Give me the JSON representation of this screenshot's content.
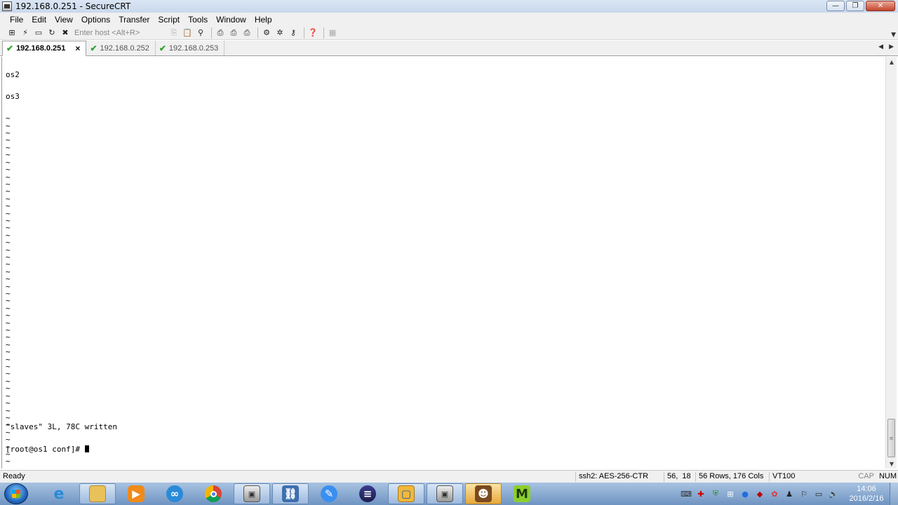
{
  "window": {
    "title": "192.168.0.251 - SecureCRT"
  },
  "menu": [
    "File",
    "Edit",
    "View",
    "Options",
    "Transfer",
    "Script",
    "Tools",
    "Window",
    "Help"
  ],
  "toolbar": {
    "host_placeholder": "Enter host <Alt+R>",
    "left_icons": [
      "connect-icon",
      "quick-connect-icon",
      "connect-tab-icon",
      "reconnect-icon",
      "disconnect-icon"
    ],
    "right_icons": [
      "copy-icon",
      "paste-icon",
      "find-icon",
      "print-icon",
      "print-selection-icon",
      "print-setup-icon",
      "session-options-icon",
      "global-options-icon",
      "keymap-icon",
      "help-icon",
      "sftp-icon"
    ]
  },
  "tabs": [
    {
      "label": "192.168.0.251",
      "active": true,
      "close": "×"
    },
    {
      "label": "192.168.0.252",
      "active": false
    },
    {
      "label": "192.168.0.253",
      "active": false
    }
  ],
  "terminal": {
    "lines": [
      "os2",
      "os3"
    ],
    "filler_char": "~",
    "filler_count": 53,
    "message": "\"slaves\" 3L, 78C written",
    "prompt": "[root@os1 conf]# "
  },
  "status": {
    "ready": "Ready",
    "cipher": "ssh2: AES-256-CTR",
    "position": "56,  18",
    "size": "56 Rows, 176 Cols",
    "emulation": "VT100",
    "cap": "CAP",
    "num": "NUM"
  },
  "taskbar": {
    "apps": [
      "internet-explorer-icon",
      "file-explorer-icon",
      "media-player-icon",
      "baidu-netdisk-icon",
      "chrome-icon",
      "securecrt-icon",
      "network-tool-icon",
      "feishu-icon",
      "eclipse-icon",
      "virtualbox-icon",
      "securecrt-window-icon",
      "game-icon",
      "mail-icon"
    ],
    "time": "14:06",
    "date": "2016/2/16"
  }
}
